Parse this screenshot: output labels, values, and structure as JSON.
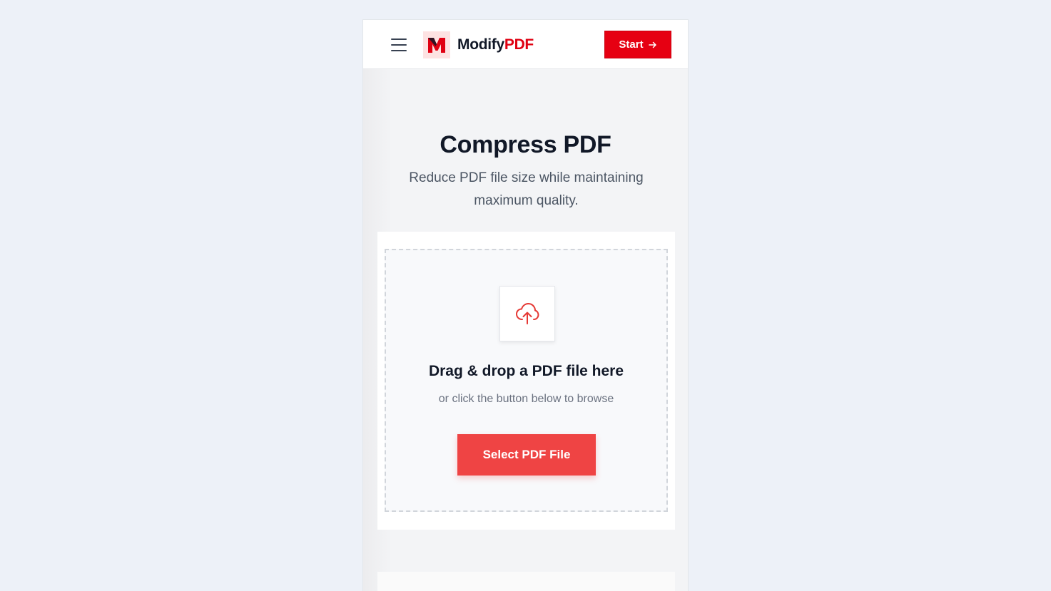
{
  "header": {
    "menu_icon": "hamburger-icon",
    "logo_icon": "modifypdf-logo-icon",
    "logo_text_main": "Modify",
    "logo_text_accent": "PDF",
    "start_label": "Start",
    "start_icon": "arrow-right-icon"
  },
  "hero": {
    "title": "Compress PDF",
    "subtitle": "Reduce PDF file size while maintaining maximum quality."
  },
  "upload": {
    "icon": "cloud-upload-icon",
    "title": "Drag & drop a PDF file here",
    "subtitle": "or click the button below to browse",
    "button_label": "Select PDF File"
  },
  "colors": {
    "brand_red": "#e60012",
    "button_red": "#ef4444",
    "text_dark": "#111827",
    "page_bg": "#edf1f8"
  }
}
